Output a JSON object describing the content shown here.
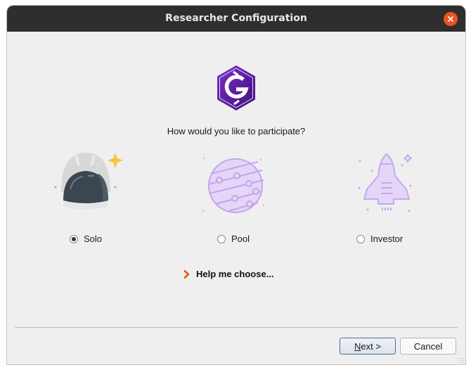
{
  "window": {
    "title": "Researcher Configuration",
    "close_icon": "close-icon"
  },
  "main": {
    "logo_icon": "gridcoin-hexagon-logo",
    "question": "How would you like to participate?",
    "options": [
      {
        "label": "Solo",
        "icon": "astronaut-helmet-icon",
        "selected": true
      },
      {
        "label": "Pool",
        "icon": "planet-icon",
        "selected": false
      },
      {
        "label": "Investor",
        "icon": "space-shuttle-icon",
        "selected": false
      }
    ],
    "help_link": "Help me choose...",
    "help_icon": "chevron-right-icon"
  },
  "footer": {
    "next_mnemonic": "N",
    "next_rest": "ext >",
    "cancel_label": "Cancel"
  },
  "colors": {
    "titlebar": "#2e2e2e",
    "close": "#e95420",
    "brand_purple": "#5b1aa0",
    "illustration_purple": "#c6a8f0",
    "help_arrow": "#e05a1c"
  }
}
